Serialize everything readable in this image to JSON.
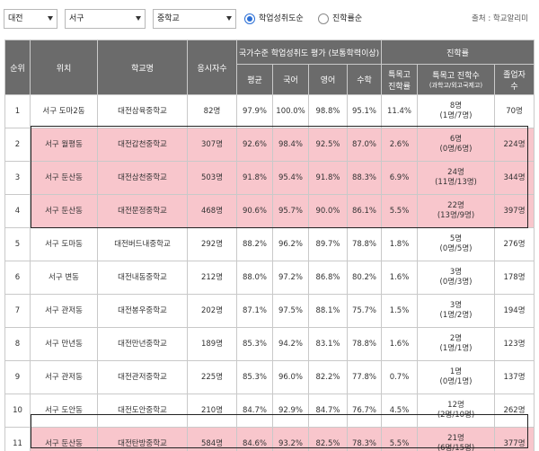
{
  "filters": {
    "region": "대전",
    "district": "서구",
    "level": "중학교",
    "radio1": "학업성취도순",
    "radio2": "진학률순",
    "source": "출처 : 학교알리미"
  },
  "header": {
    "rank": "순위",
    "location": "위치",
    "school": "학교명",
    "applicants": "응시자수",
    "achievement_group": "국가수준 학업성취도 평가 (보통학력이상)",
    "avg": "평균",
    "korean": "국어",
    "english": "영어",
    "math": "수학",
    "admission_group": "진학률",
    "special_rate_1": "특목고",
    "special_rate_2": "진학률",
    "special_count_1": "특목고 진학수",
    "special_count_2": "(과학고/외고국제고)",
    "grads_1": "졸업자",
    "grads_2": "수"
  },
  "rows": [
    {
      "rank": "1",
      "location": "서구 도마2동",
      "school": "대전삼육중학교",
      "applicants": "82명",
      "avg": "97.9%",
      "korean": "100.0%",
      "english": "98.8%",
      "math": "95.1%",
      "special_rate": "11.4%",
      "special_count": "8명",
      "special_detail": "(1명/7명)",
      "grads": "70명",
      "highlight": false
    },
    {
      "rank": "2",
      "location": "서구 월평동",
      "school": "대전갑천중학교",
      "applicants": "307명",
      "avg": "92.6%",
      "korean": "98.4%",
      "english": "92.5%",
      "math": "87.0%",
      "special_rate": "2.6%",
      "special_count": "6명",
      "special_detail": "(0명/6명)",
      "grads": "224명",
      "highlight": true
    },
    {
      "rank": "3",
      "location": "서구 둔산동",
      "school": "대전삼천중학교",
      "applicants": "503명",
      "avg": "91.8%",
      "korean": "95.4%",
      "english": "91.8%",
      "math": "88.3%",
      "special_rate": "6.9%",
      "special_count": "24명",
      "special_detail": "(11명/13명)",
      "grads": "344명",
      "highlight": true
    },
    {
      "rank": "4",
      "location": "서구 둔산동",
      "school": "대전문정중학교",
      "applicants": "468명",
      "avg": "90.6%",
      "korean": "95.7%",
      "english": "90.0%",
      "math": "86.1%",
      "special_rate": "5.5%",
      "special_count": "22명",
      "special_detail": "(13명/9명)",
      "grads": "397명",
      "highlight": true
    },
    {
      "rank": "5",
      "location": "서구 도마동",
      "school": "대전버드내중학교",
      "applicants": "292명",
      "avg": "88.2%",
      "korean": "96.2%",
      "english": "89.7%",
      "math": "78.8%",
      "special_rate": "1.8%",
      "special_count": "5명",
      "special_detail": "(0명/5명)",
      "grads": "276명",
      "highlight": false
    },
    {
      "rank": "6",
      "location": "서구 변동",
      "school": "대전내동중학교",
      "applicants": "212명",
      "avg": "88.0%",
      "korean": "97.2%",
      "english": "86.8%",
      "math": "80.2%",
      "special_rate": "1.6%",
      "special_count": "3명",
      "special_detail": "(0명/3명)",
      "grads": "178명",
      "highlight": false
    },
    {
      "rank": "7",
      "location": "서구 관저동",
      "school": "대전봉우중학교",
      "applicants": "202명",
      "avg": "87.1%",
      "korean": "97.5%",
      "english": "88.1%",
      "math": "75.7%",
      "special_rate": "1.5%",
      "special_count": "3명",
      "special_detail": "(1명/2명)",
      "grads": "194명",
      "highlight": false
    },
    {
      "rank": "8",
      "location": "서구 만년동",
      "school": "대전만년중학교",
      "applicants": "189명",
      "avg": "85.3%",
      "korean": "94.2%",
      "english": "83.1%",
      "math": "78.8%",
      "special_rate": "1.6%",
      "special_count": "2명",
      "special_detail": "(1명/1명)",
      "grads": "123명",
      "highlight": false
    },
    {
      "rank": "9",
      "location": "서구 관저동",
      "school": "대전관저중학교",
      "applicants": "225명",
      "avg": "85.3%",
      "korean": "96.0%",
      "english": "82.2%",
      "math": "77.8%",
      "special_rate": "0.7%",
      "special_count": "1명",
      "special_detail": "(0명/1명)",
      "grads": "137명",
      "highlight": false
    },
    {
      "rank": "10",
      "location": "서구 도안동",
      "school": "대전도안중학교",
      "applicants": "210명",
      "avg": "84.7%",
      "korean": "92.9%",
      "english": "84.7%",
      "math": "76.7%",
      "special_rate": "4.5%",
      "special_count": "12명",
      "special_detail": "(2명/10명)",
      "grads": "262명",
      "highlight": false
    },
    {
      "rank": "11",
      "location": "서구 둔산동",
      "school": "대전탄방중학교",
      "applicants": "584명",
      "avg": "84.6%",
      "korean": "93.2%",
      "english": "82.5%",
      "math": "78.3%",
      "special_rate": "5.5%",
      "special_count": "21명",
      "special_detail": "(6명/15명)",
      "grads": "377명",
      "highlight": true
    }
  ]
}
